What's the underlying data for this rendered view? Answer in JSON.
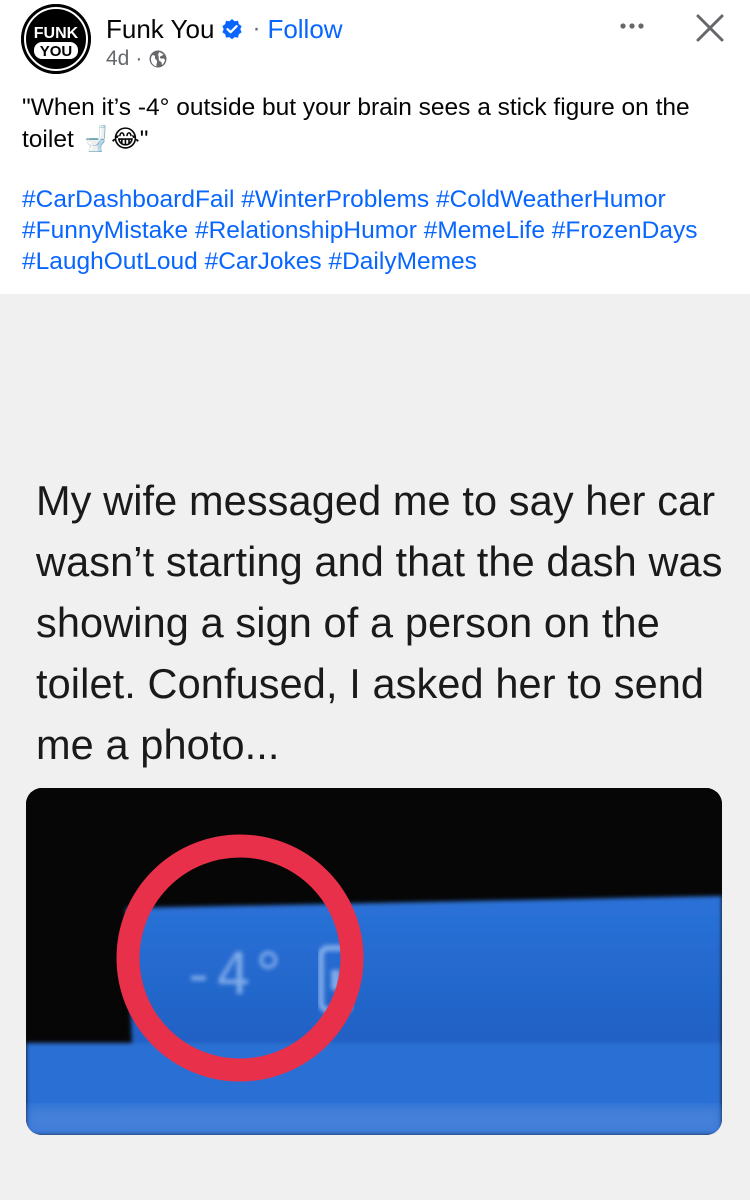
{
  "post": {
    "author": "Funk You",
    "avatar_text": {
      "top": "FUNK",
      "bottom": "YOU"
    },
    "verified_icon": "verified-badge-icon",
    "separator": "·",
    "follow_label": "Follow",
    "time": "4d",
    "audience_icon": "globe-icon",
    "more_icon": "more-dots-icon",
    "close_icon": "close-icon",
    "caption": "\"When it’s -4° outside but your brain sees a stick figure on the toilet 🚽😂\"",
    "hashtags": [
      "#CarDashboardFail",
      "#WinterProblems",
      "#ColdWeatherHumor",
      "#FunnyMistake",
      "#RelationshipHumor",
      "#MemeLife",
      "#FrozenDays",
      "#LaughOutLoud",
      "#CarJokes",
      "#DailyMemes"
    ]
  },
  "meme": {
    "text": "My wife messaged me to say her car wasn’t starting and that the dash was showing a sign of a person on the toilet. Confused, I asked her to send me a photo...",
    "dash_reading": "-4°",
    "colors": {
      "highlight_circle": "#e8304a",
      "dash_blue": "#1e63c9",
      "link": "#0866ff"
    }
  }
}
